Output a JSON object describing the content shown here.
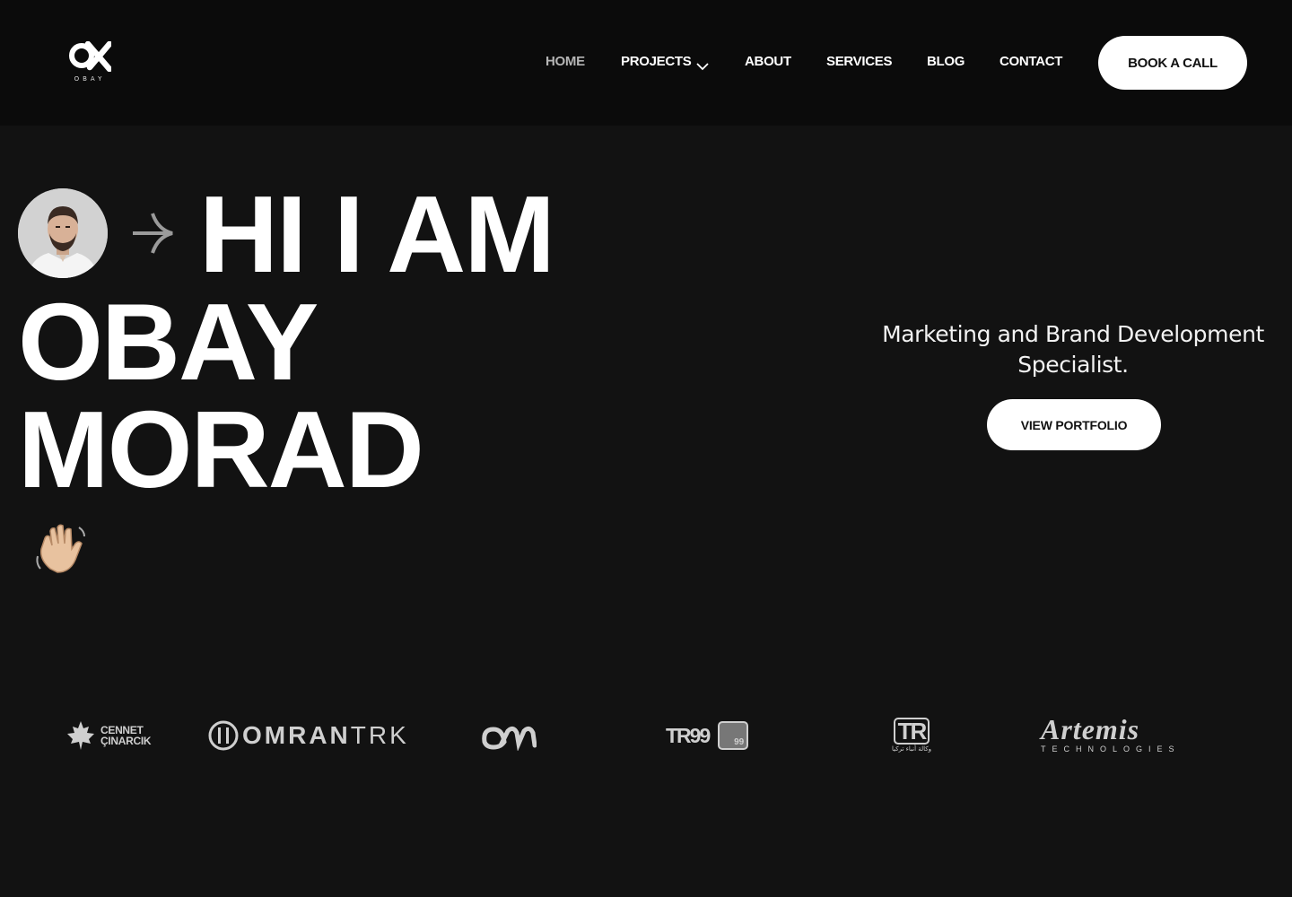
{
  "brand": {
    "logo_mark": "OX",
    "logo_sub": "OBAY",
    "icon": "ox-logo-icon"
  },
  "nav": {
    "items": [
      {
        "label": "HOME",
        "active": true
      },
      {
        "label": "PROJECTS",
        "has_dropdown": true
      },
      {
        "label": "ABOUT"
      },
      {
        "label": "SERVICES"
      },
      {
        "label": "BLOG"
      },
      {
        "label": "CONTACT"
      }
    ],
    "cta": "BOOK A CALL"
  },
  "hero": {
    "line1": "HI I AM",
    "line2": "OBAY",
    "line3": "MORAD",
    "avatar_icon": "profile-photo",
    "arrow_icon": "arrow-right-icon",
    "wave_icon": "waving-hand-icon",
    "tagline": "Marketing and Brand Development Specialist.",
    "cta": "VIEW PORTFOLIO"
  },
  "clients": [
    {
      "name": "CENNET ÇINARCIK",
      "line1": "CENNET",
      "line2": "ÇINARCIK"
    },
    {
      "name": "OMRANTRK",
      "part1": "OMRAN",
      "part2": "TRK"
    },
    {
      "name": "om"
    },
    {
      "name": "TR99",
      "badge": "99"
    },
    {
      "name": "TR",
      "sub": "وكالة أنباء تركيا"
    },
    {
      "name": "Artemis",
      "sub": "TECHNOLOGIES"
    }
  ],
  "colors": {
    "background": "#121212",
    "header": "#0b0b0b",
    "text": "#ffffff",
    "nav_active": "#b5b5b5",
    "button_bg": "#ffffff",
    "button_text": "#111111",
    "logo_gray": "#cfcfcf"
  }
}
